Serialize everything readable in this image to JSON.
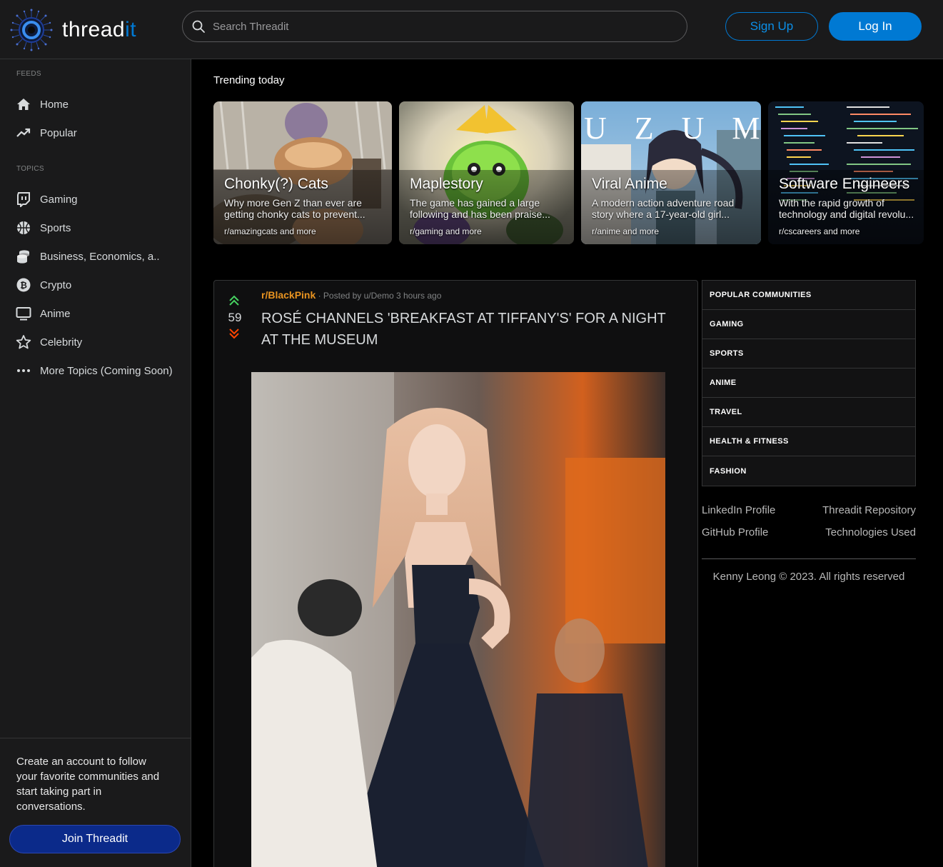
{
  "header": {
    "logo_text_main": "thread",
    "logo_text_accent": "it",
    "search_placeholder": "Search Threadit",
    "signup_label": "Sign Up",
    "login_label": "Log In"
  },
  "sidebar": {
    "feeds_label": "FEEDS",
    "topics_label": "TOPICS",
    "feeds": [
      {
        "label": "Home",
        "icon": "home-icon"
      },
      {
        "label": "Popular",
        "icon": "trending-icon"
      }
    ],
    "topics": [
      {
        "label": "Gaming",
        "icon": "twitch-icon"
      },
      {
        "label": "Sports",
        "icon": "basketball-icon"
      },
      {
        "label": "Business, Economics, a..",
        "icon": "coins-icon"
      },
      {
        "label": "Crypto",
        "icon": "bitcoin-icon"
      },
      {
        "label": "Anime",
        "icon": "tv-icon"
      },
      {
        "label": "Celebrity",
        "icon": "star-icon"
      },
      {
        "label": "More Topics (Coming Soon)",
        "icon": "more-icon"
      }
    ],
    "cta_text": "Create an account to follow your favorite communities and start taking part in conversations.",
    "join_label": "Join Threadit"
  },
  "trending": {
    "title": "Trending today",
    "cards": [
      {
        "title": "Chonky(?) Cats",
        "desc": "Why more Gen Z than ever are getting chonky cats to prevent...",
        "sub": "r/amazingcats and more"
      },
      {
        "title": "Maplestory",
        "desc": "The game has gained a large following and has been praise...",
        "sub": "r/gaming and more"
      },
      {
        "title": "Viral Anime",
        "desc": "A modern action adventure road story where a 17-year-old girl...",
        "sub": "r/anime and more"
      },
      {
        "title": "Software Engineers",
        "desc": "With the rapid growth of technology and digital revolu...",
        "sub": "r/cscareers and more"
      }
    ],
    "anime_overlay_text": "U Z U M I"
  },
  "post": {
    "votes": "59",
    "subreddit": "r/BlackPink",
    "meta": " · Posted by u/Demo 3 hours ago",
    "title": "ROSÉ CHANNELS 'BREAKFAST AT TIFFANY'S' FOR A NIGHT AT THE MUSEUM"
  },
  "right": {
    "communities": [
      "POPULAR COMMUNITIES",
      "GAMING",
      "SPORTS",
      "ANIME",
      "TRAVEL",
      "HEALTH & FITNESS",
      "FASHION"
    ],
    "links": {
      "linkedin": "LinkedIn Profile",
      "repo": "Threadit Repository",
      "github": "GitHub Profile",
      "tech": "Technologies Used"
    },
    "copyright": "Kenny Leong © 2023. All rights reserved"
  },
  "colors": {
    "accent": "#0079d3",
    "subreddit": "#e89320",
    "upvote": "#46d160",
    "downvote": "#ff4500",
    "join_button": "#0b2a8a"
  }
}
